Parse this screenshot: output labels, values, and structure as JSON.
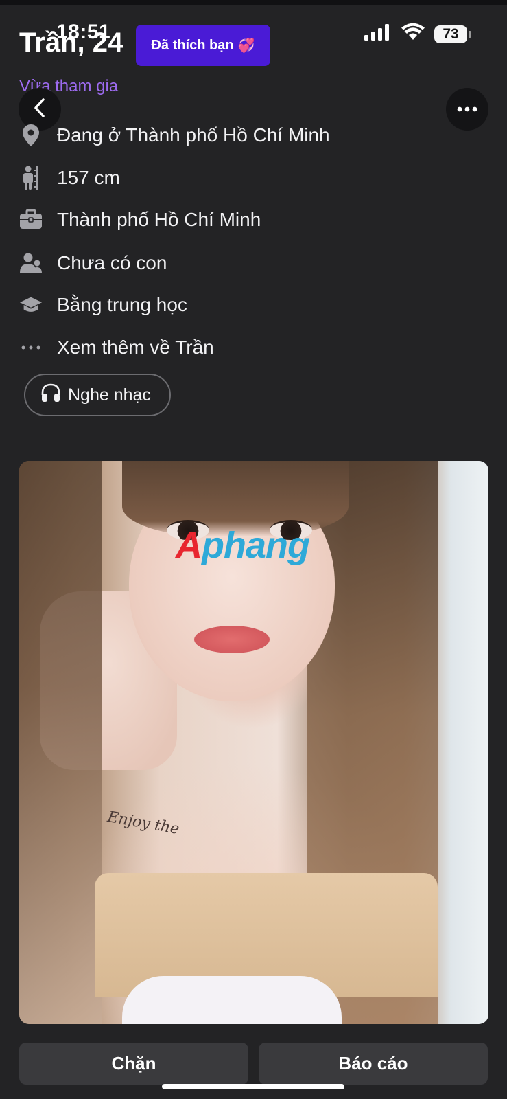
{
  "status_bar": {
    "time": "18:51",
    "battery": "73",
    "icons": [
      "signal-icon",
      "wifi-icon",
      "battery-icon"
    ]
  },
  "header": {
    "name_age": "Trần, 24",
    "liked_badge": "Đã thích bạn",
    "liked_badge_emoji": "💞",
    "just_joined": "Vừa tham gia"
  },
  "info": {
    "location": "Đang ở Thành phố Hồ Chí Minh",
    "height": "157 cm",
    "work": "Thành phố Hồ Chí Minh",
    "children": "Chưa có con",
    "education": "Bằng trung học",
    "see_more": "Xem thêm về Trần"
  },
  "music": {
    "label": "Nghe nhạc"
  },
  "photo": {
    "watermark_a": "A",
    "watermark_rest": "phang",
    "tattoo_text": "Enjoy the"
  },
  "actions": {
    "block": "Chặn",
    "report": "Báo cáo"
  },
  "colors": {
    "background": "#232325",
    "accent_purple": "#4a1bd6",
    "joined_purple": "#9d6bf0",
    "button_gray": "#3a3a3d"
  }
}
